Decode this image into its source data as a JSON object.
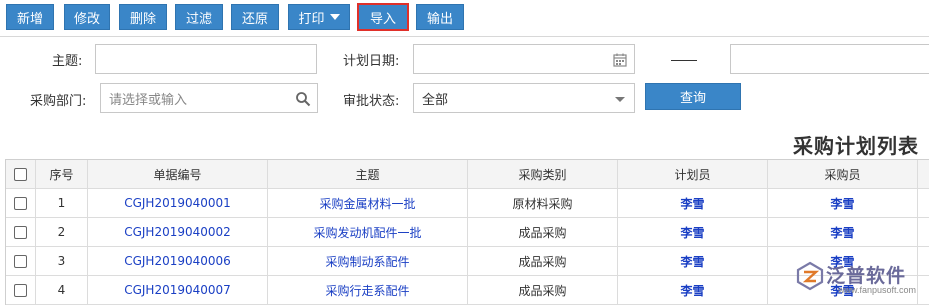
{
  "toolbar": {
    "buttons": [
      {
        "label": "新增"
      },
      {
        "label": "修改"
      },
      {
        "label": "删除"
      },
      {
        "label": "过滤"
      },
      {
        "label": "还原"
      },
      {
        "label": "打印"
      },
      {
        "label": "导入"
      },
      {
        "label": "输出"
      }
    ]
  },
  "search": {
    "subject_label": "主题:",
    "subject_value": "",
    "plan_date_label": "计划日期:",
    "plan_date_start": "",
    "plan_date_end": "",
    "dept_label": "采购部门:",
    "dept_placeholder": "请选择或输入",
    "status_label": "审批状态:",
    "status_value": "全部",
    "query_label": "查询"
  },
  "page_title": "采购计划列表",
  "table": {
    "headers": [
      "序号",
      "单据编号",
      "主题",
      "采购类别",
      "计划员",
      "采购员"
    ],
    "rows": [
      {
        "seq": "1",
        "no": "CGJH2019040001",
        "subject": "采购金属材料一批",
        "category": "原材料采购",
        "planner": "李雪",
        "buyer": "李雪"
      },
      {
        "seq": "2",
        "no": "CGJH2019040002",
        "subject": "采购发动机配件一批",
        "category": "成品采购",
        "planner": "李雪",
        "buyer": "李雪"
      },
      {
        "seq": "3",
        "no": "CGJH2019040006",
        "subject": "采购制动系配件",
        "category": "成品采购",
        "planner": "李雪",
        "buyer": "李雪"
      },
      {
        "seq": "4",
        "no": "CGJH2019040007",
        "subject": "采购行走系配件",
        "category": "成品采购",
        "planner": "李雪",
        "buyer": "李雪"
      }
    ]
  },
  "watermark": {
    "name": "泛普软件",
    "url": "www.fanpusoft.com"
  },
  "colors": {
    "accent": "#3a86c8",
    "highlight_border": "#e0302a",
    "link": "#1a3fc4"
  }
}
